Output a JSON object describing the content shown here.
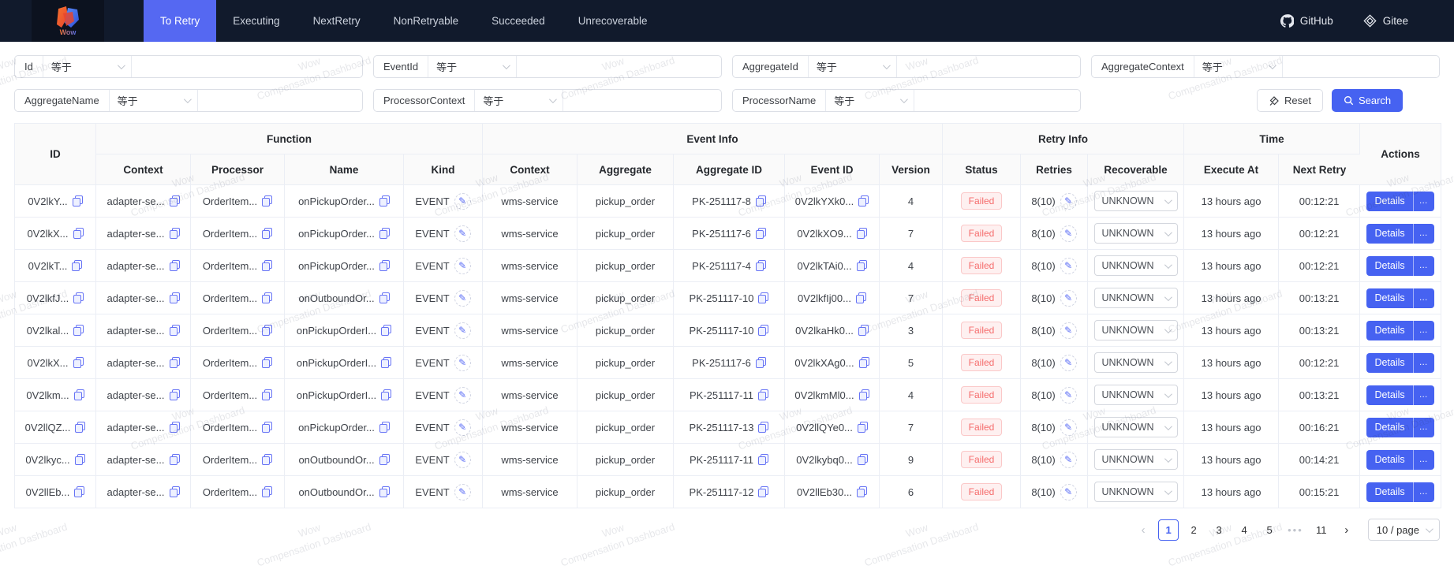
{
  "navbar": {
    "logo_text": "Wow",
    "tabs": [
      {
        "label": "To Retry",
        "active": true
      },
      {
        "label": "Executing",
        "active": false
      },
      {
        "label": "NextRetry",
        "active": false
      },
      {
        "label": "NonRetryable",
        "active": false
      },
      {
        "label": "Succeeded",
        "active": false
      },
      {
        "label": "Unrecoverable",
        "active": false
      }
    ],
    "links": [
      {
        "label": "GitHub",
        "icon": "github-icon"
      },
      {
        "label": "Gitee",
        "icon": "gitee-icon"
      }
    ]
  },
  "filters": {
    "row1": [
      {
        "label": "Id",
        "operator": "等于"
      },
      {
        "label": "EventId",
        "operator": "等于"
      },
      {
        "label": "AggregateId",
        "operator": "等于"
      },
      {
        "label": "AggregateContext",
        "operator": "等于"
      }
    ],
    "row2": [
      {
        "label": "AggregateName",
        "operator": "等于"
      },
      {
        "label": "ProcessorContext",
        "operator": "等于"
      },
      {
        "label": "ProcessorName",
        "operator": "等于"
      }
    ],
    "reset_label": "Reset",
    "search_label": "Search"
  },
  "table": {
    "header": {
      "id": "ID",
      "function_group": "Function",
      "event_info_group": "Event Info",
      "retry_info_group": "Retry Info",
      "time_group": "Time",
      "actions": "Actions",
      "fn_context": "Context",
      "fn_processor": "Processor",
      "fn_name": "Name",
      "fn_kind": "Kind",
      "ev_context": "Context",
      "ev_aggregate": "Aggregate",
      "ev_aggregate_id": "Aggregate ID",
      "ev_event_id": "Event ID",
      "ev_version": "Version",
      "status": "Status",
      "retries": "Retries",
      "recoverable": "Recoverable",
      "execute_at": "Execute At",
      "next_retry": "Next Retry"
    },
    "rows": [
      {
        "id": "0V2lkY...",
        "fn_context": "adapter-se...",
        "fn_processor": "OrderItem...",
        "fn_name": "onPickupOrder...",
        "kind": "EVENT",
        "ev_context": "wms-service",
        "aggregate": "pickup_order",
        "aggregate_id": "PK-251117-8",
        "event_id": "0V2lkYXk0...",
        "version": "4",
        "status": "Failed",
        "retries": "8(10)",
        "recoverable": "UNKNOWN",
        "execute_at": "13 hours ago",
        "next_retry": "00:12:21",
        "details": "Details",
        "more": "…"
      },
      {
        "id": "0V2lkX...",
        "fn_context": "adapter-se...",
        "fn_processor": "OrderItem...",
        "fn_name": "onPickupOrder...",
        "kind": "EVENT",
        "ev_context": "wms-service",
        "aggregate": "pickup_order",
        "aggregate_id": "PK-251117-6",
        "event_id": "0V2lkXO9...",
        "version": "7",
        "status": "Failed",
        "retries": "8(10)",
        "recoverable": "UNKNOWN",
        "execute_at": "13 hours ago",
        "next_retry": "00:12:21",
        "details": "Details",
        "more": "…"
      },
      {
        "id": "0V2lkT...",
        "fn_context": "adapter-se...",
        "fn_processor": "OrderItem...",
        "fn_name": "onPickupOrder...",
        "kind": "EVENT",
        "ev_context": "wms-service",
        "aggregate": "pickup_order",
        "aggregate_id": "PK-251117-4",
        "event_id": "0V2lkTAi0...",
        "version": "4",
        "status": "Failed",
        "retries": "8(10)",
        "recoverable": "UNKNOWN",
        "execute_at": "13 hours ago",
        "next_retry": "00:12:21",
        "details": "Details",
        "more": "…"
      },
      {
        "id": "0V2lkfJ...",
        "fn_context": "adapter-se...",
        "fn_processor": "OrderItem...",
        "fn_name": "onOutboundOr...",
        "kind": "EVENT",
        "ev_context": "wms-service",
        "aggregate": "pickup_order",
        "aggregate_id": "PK-251117-10",
        "event_id": "0V2lkfIj00...",
        "version": "7",
        "status": "Failed",
        "retries": "8(10)",
        "recoverable": "UNKNOWN",
        "execute_at": "13 hours ago",
        "next_retry": "00:13:21",
        "details": "Details",
        "more": "…"
      },
      {
        "id": "0V2lkal...",
        "fn_context": "adapter-se...",
        "fn_processor": "OrderItem...",
        "fn_name": "onPickupOrderI...",
        "kind": "EVENT",
        "ev_context": "wms-service",
        "aggregate": "pickup_order",
        "aggregate_id": "PK-251117-10",
        "event_id": "0V2lkaHk0...",
        "version": "3",
        "status": "Failed",
        "retries": "8(10)",
        "recoverable": "UNKNOWN",
        "execute_at": "13 hours ago",
        "next_retry": "00:13:21",
        "details": "Details",
        "more": "…"
      },
      {
        "id": "0V2lkX...",
        "fn_context": "adapter-se...",
        "fn_processor": "OrderItem...",
        "fn_name": "onPickupOrderI...",
        "kind": "EVENT",
        "ev_context": "wms-service",
        "aggregate": "pickup_order",
        "aggregate_id": "PK-251117-6",
        "event_id": "0V2lkXAg0...",
        "version": "5",
        "status": "Failed",
        "retries": "8(10)",
        "recoverable": "UNKNOWN",
        "execute_at": "13 hours ago",
        "next_retry": "00:12:21",
        "details": "Details",
        "more": "…"
      },
      {
        "id": "0V2lkm...",
        "fn_context": "adapter-se...",
        "fn_processor": "OrderItem...",
        "fn_name": "onPickupOrderI...",
        "kind": "EVENT",
        "ev_context": "wms-service",
        "aggregate": "pickup_order",
        "aggregate_id": "PK-251117-11",
        "event_id": "0V2lkmMl0...",
        "version": "4",
        "status": "Failed",
        "retries": "8(10)",
        "recoverable": "UNKNOWN",
        "execute_at": "13 hours ago",
        "next_retry": "00:13:21",
        "details": "Details",
        "more": "…"
      },
      {
        "id": "0V2llQZ...",
        "fn_context": "adapter-se...",
        "fn_processor": "OrderItem...",
        "fn_name": "onPickupOrder...",
        "kind": "EVENT",
        "ev_context": "wms-service",
        "aggregate": "pickup_order",
        "aggregate_id": "PK-251117-13",
        "event_id": "0V2llQYe0...",
        "version": "7",
        "status": "Failed",
        "retries": "8(10)",
        "recoverable": "UNKNOWN",
        "execute_at": "13 hours ago",
        "next_retry": "00:16:21",
        "details": "Details",
        "more": "…"
      },
      {
        "id": "0V2lkyc...",
        "fn_context": "adapter-se...",
        "fn_processor": "OrderItem...",
        "fn_name": "onOutboundOr...",
        "kind": "EVENT",
        "ev_context": "wms-service",
        "aggregate": "pickup_order",
        "aggregate_id": "PK-251117-11",
        "event_id": "0V2lkybq0...",
        "version": "9",
        "status": "Failed",
        "retries": "8(10)",
        "recoverable": "UNKNOWN",
        "execute_at": "13 hours ago",
        "next_retry": "00:14:21",
        "details": "Details",
        "more": "…"
      },
      {
        "id": "0V2llEb...",
        "fn_context": "adapter-se...",
        "fn_processor": "OrderItem...",
        "fn_name": "onOutboundOr...",
        "kind": "EVENT",
        "ev_context": "wms-service",
        "aggregate": "pickup_order",
        "aggregate_id": "PK-251117-12",
        "event_id": "0V2llEb30...",
        "version": "6",
        "status": "Failed",
        "retries": "8(10)",
        "recoverable": "UNKNOWN",
        "execute_at": "13 hours ago",
        "next_retry": "00:15:21",
        "details": "Details",
        "more": "…"
      }
    ]
  },
  "pagination": {
    "items": [
      {
        "type": "prev",
        "label": "‹"
      },
      {
        "type": "page",
        "label": "1",
        "current": true
      },
      {
        "type": "page",
        "label": "2"
      },
      {
        "type": "page",
        "label": "3"
      },
      {
        "type": "page",
        "label": "4"
      },
      {
        "type": "page",
        "label": "5"
      },
      {
        "type": "dots",
        "label": "•••"
      },
      {
        "type": "page",
        "label": "11"
      },
      {
        "type": "next",
        "label": "›"
      }
    ],
    "page_size": "10 / page"
  },
  "watermark": {
    "line1": "Wow",
    "line2": "Compensation Dashboard"
  },
  "colors": {
    "navbar_bg": "#111a2c",
    "tab_active": "#5568f2",
    "primary": "#4662f1",
    "failed_text": "#f56c6c",
    "failed_bg": "#fef0f0",
    "copy_icon": "#6673f5"
  }
}
